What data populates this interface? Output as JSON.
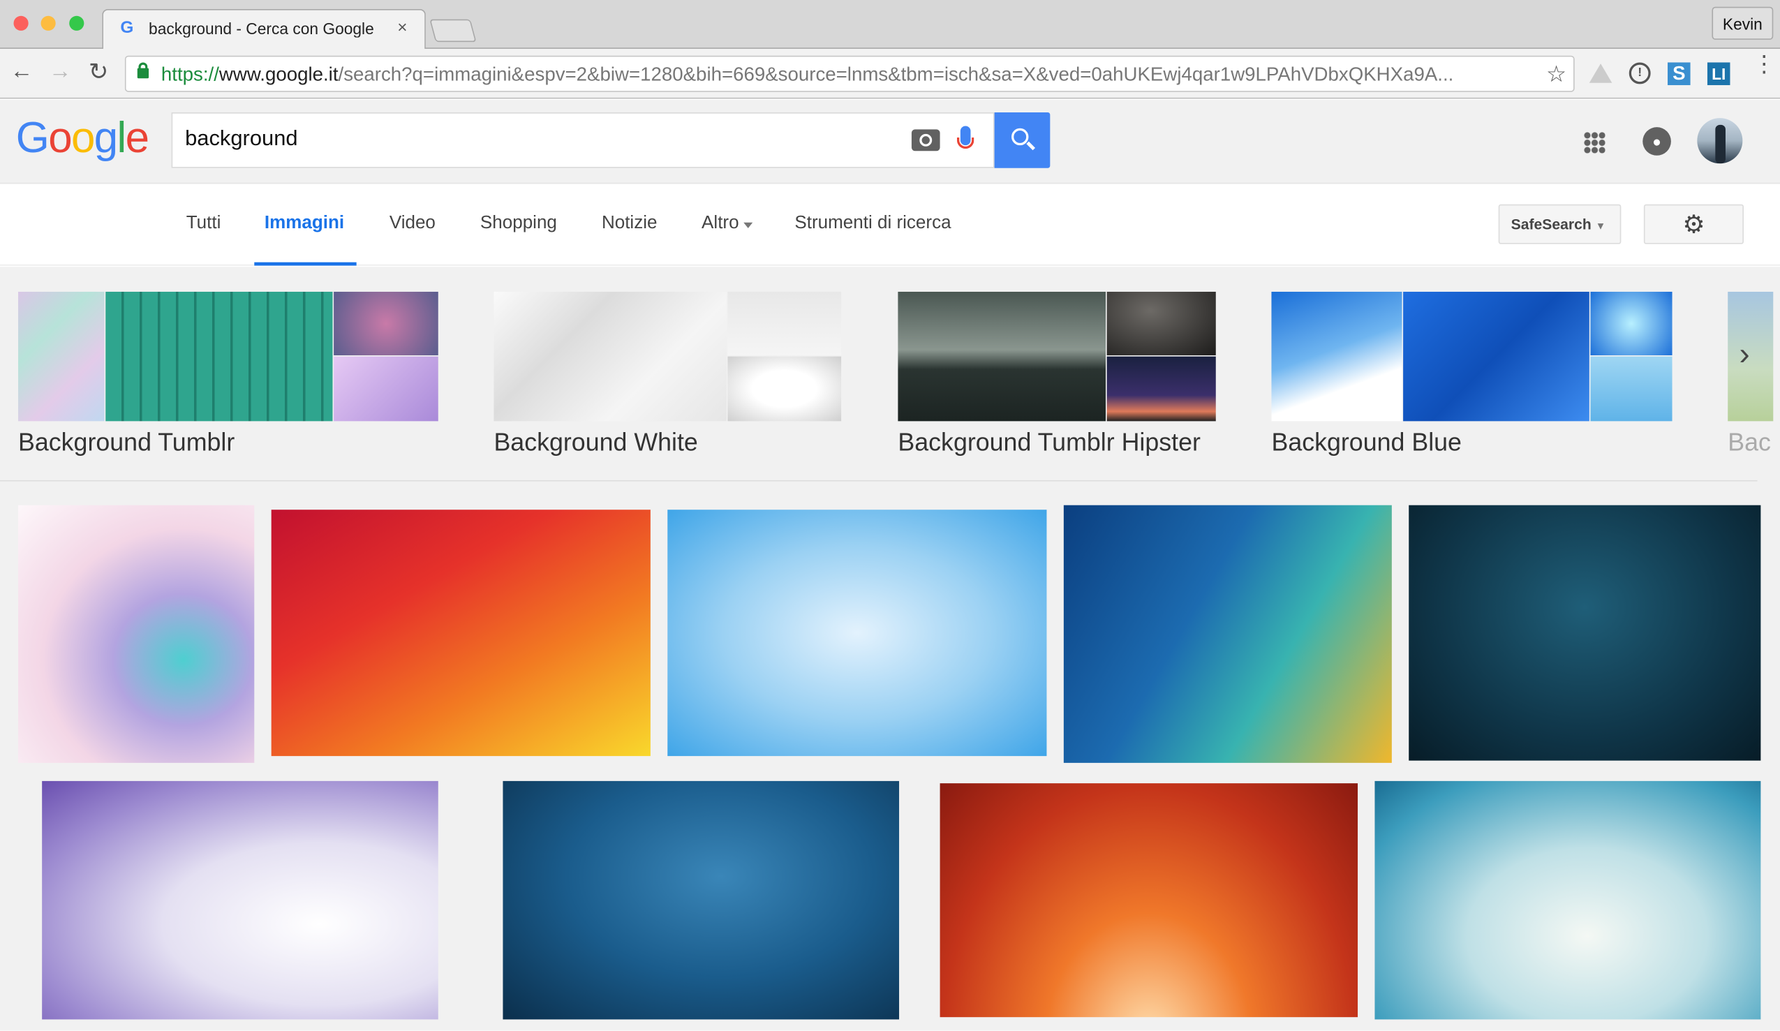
{
  "browser": {
    "tab_title": "background - Cerca con Google",
    "profile_name": "Kevin",
    "url_scheme": "https://",
    "url_host": "www.google.it",
    "url_path": "/search?q=immagini&espv=2&biw=1280&bih=669&source=lnms&tbm=isch&sa=X&ved=0ahUKEwj4qar1w9LPAhVDbxQKHXa9A...",
    "icons": [
      "back-icon",
      "forward-icon",
      "reload-icon",
      "lock-icon",
      "star-icon",
      "drive-icon",
      "1password-icon",
      "s-extension-icon",
      "li-extension-icon",
      "menu-icon"
    ]
  },
  "header": {
    "logo": "Google",
    "search_value": "background",
    "icons": [
      "camera-icon",
      "mic-icon",
      "search-icon",
      "apps-icon",
      "notifications-icon",
      "avatar"
    ]
  },
  "nav": {
    "tabs": [
      {
        "label": "Tutti",
        "active": false
      },
      {
        "label": "Immagini",
        "active": true
      },
      {
        "label": "Video",
        "active": false
      },
      {
        "label": "Shopping",
        "active": false
      },
      {
        "label": "Notizie",
        "active": false
      },
      {
        "label": "Altro",
        "active": false
      },
      {
        "label": "Strumenti di ricerca",
        "active": false
      }
    ],
    "safesearch_label": "SafeSearch",
    "accent": "#1a73e8"
  },
  "related": [
    {
      "label": "Background Tumblr"
    },
    {
      "label": "Background White"
    },
    {
      "label": "Background Tumblr Hipster"
    },
    {
      "label": "Background Blue"
    },
    {
      "label": "Bac"
    }
  ]
}
